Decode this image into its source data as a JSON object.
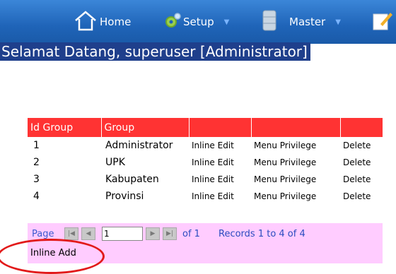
{
  "nav": {
    "home_label": "Home",
    "setup_label": "Setup",
    "master_label": "Master",
    "caret": "▼"
  },
  "welcome_text": "Selamat Datang, superuser [Administrator]",
  "table": {
    "headers": [
      "Id Group",
      "Group",
      "",
      "",
      ""
    ],
    "rows": [
      {
        "id": "1",
        "group": "Administrator",
        "edit": "Inline Edit",
        "privilege": "Menu Privilege",
        "delete": "Delete"
      },
      {
        "id": "2",
        "group": "UPK",
        "edit": "Inline Edit",
        "privilege": "Menu Privilege",
        "delete": "Delete"
      },
      {
        "id": "3",
        "group": "Kabupaten",
        "edit": "Inline Edit",
        "privilege": "Menu Privilege",
        "delete": "Delete"
      },
      {
        "id": "4",
        "group": "Provinsi",
        "edit": "Inline Edit",
        "privilege": "Menu Privilege",
        "delete": "Delete"
      }
    ]
  },
  "pager": {
    "page_label": "Page",
    "page_value": "1",
    "of_label": "of 1",
    "records_text": "Records 1 to 4 of 4"
  },
  "inline_add_label": "Inline Add",
  "colors": {
    "nav_bg": "#1f64b8",
    "header_bg": "#ff3333",
    "pager_bg": "#ffccff",
    "highlight_circle": "#e21a1a"
  }
}
